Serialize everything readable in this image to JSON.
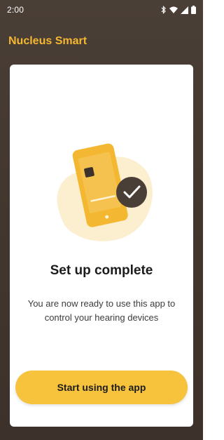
{
  "status_bar": {
    "time": "2:00",
    "icons": [
      "bluetooth-icon",
      "wifi-icon",
      "signal-icon",
      "battery-icon"
    ]
  },
  "app": {
    "title": "Nucleus Smart"
  },
  "card": {
    "illustration": "phone-checkmark-illustration",
    "heading": "Set up complete",
    "body": "You are now ready to use this app to control your hearing devices",
    "primary_button_label": "Start using the app"
  },
  "colors": {
    "background": "#433930",
    "accent": "#f4b731",
    "button": "#f7c33c",
    "card": "#ffffff"
  }
}
